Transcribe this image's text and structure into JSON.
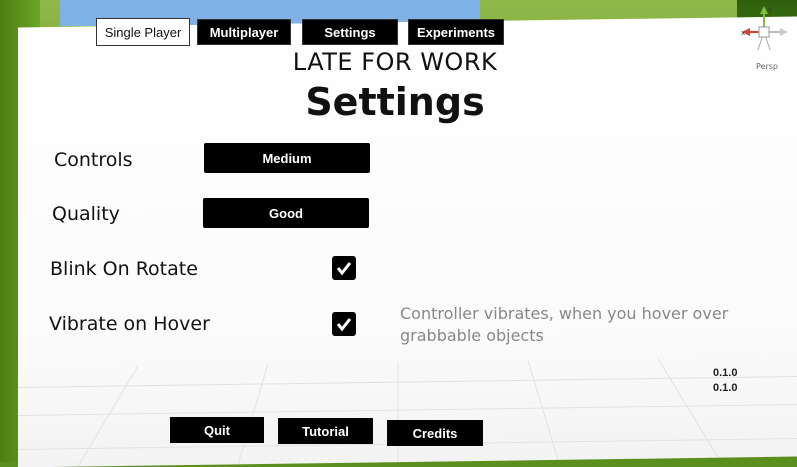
{
  "tabs": {
    "single_player": "Single Player",
    "multiplayer": "Multiplayer",
    "settings": "Settings",
    "experiments": "Experiments"
  },
  "header": {
    "game_title": "LATE FOR WORK",
    "page_title": "Settings"
  },
  "settings": {
    "controls_label": "Controls",
    "controls_value": "Medium",
    "quality_label": "Quality",
    "quality_value": "Good",
    "blink_label": "Blink On Rotate",
    "blink_checked": true,
    "vibrate_label": "Vibrate on Hover",
    "vibrate_checked": true,
    "vibrate_hint": "Controller vibrates, when you hover over grabbable objects"
  },
  "versions": [
    "0.1.0",
    "0.1.0"
  ],
  "buttons": {
    "quit": "Quit",
    "tutorial": "Tutorial",
    "credits": "Credits"
  },
  "scene_view": {
    "projection_label": "Persp",
    "axis_labels": [
      "x",
      "y"
    ]
  },
  "colors": {
    "panel": "#ffffff",
    "control_bg": "#000000",
    "hint_text": "#888888",
    "grass": "#5b8f1e"
  },
  "icons": [
    "checkmark-icon",
    "scene-gizmo-icon"
  ]
}
